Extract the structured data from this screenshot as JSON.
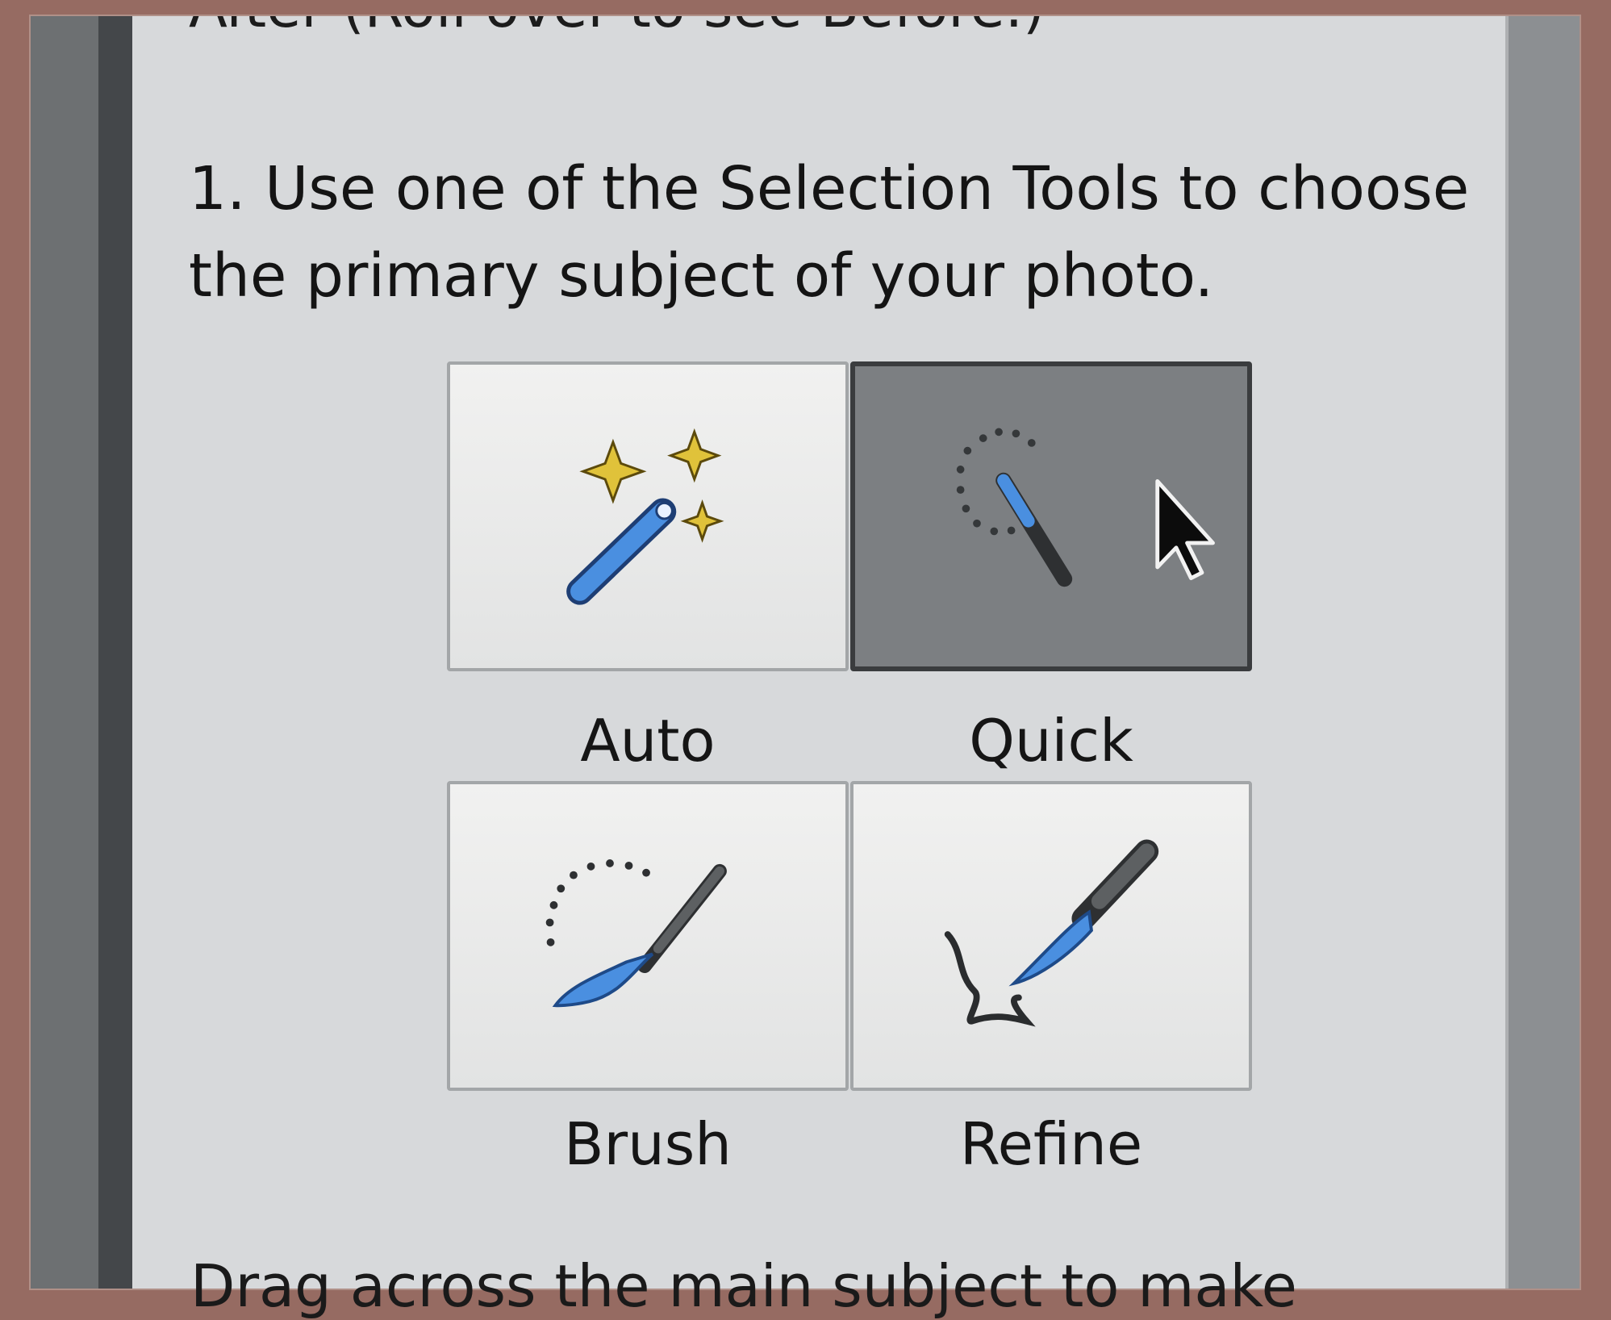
{
  "panel": {
    "heading_partial": "After (Roll over to see Before.)",
    "step1_text": "1. Use one of the Selection Tools to choose the primary subject of your photo.",
    "instruction_bottom": "Drag across the main subject to make"
  },
  "tools": [
    {
      "label": "Auto",
      "icon": "magic-wand-icon",
      "selected": false
    },
    {
      "label": "Quick",
      "icon": "quick-selection-icon",
      "selected": true
    },
    {
      "label": "Brush",
      "icon": "selection-brush-icon",
      "selected": false
    },
    {
      "label": "Refine",
      "icon": "refine-selection-brush-icon",
      "selected": false
    }
  ],
  "colors": {
    "tool_blue": "#4a8fe0",
    "sparkle_yellow": "#e0c23a",
    "selected_button": "#7c7f82",
    "page_background": "#966b62"
  }
}
